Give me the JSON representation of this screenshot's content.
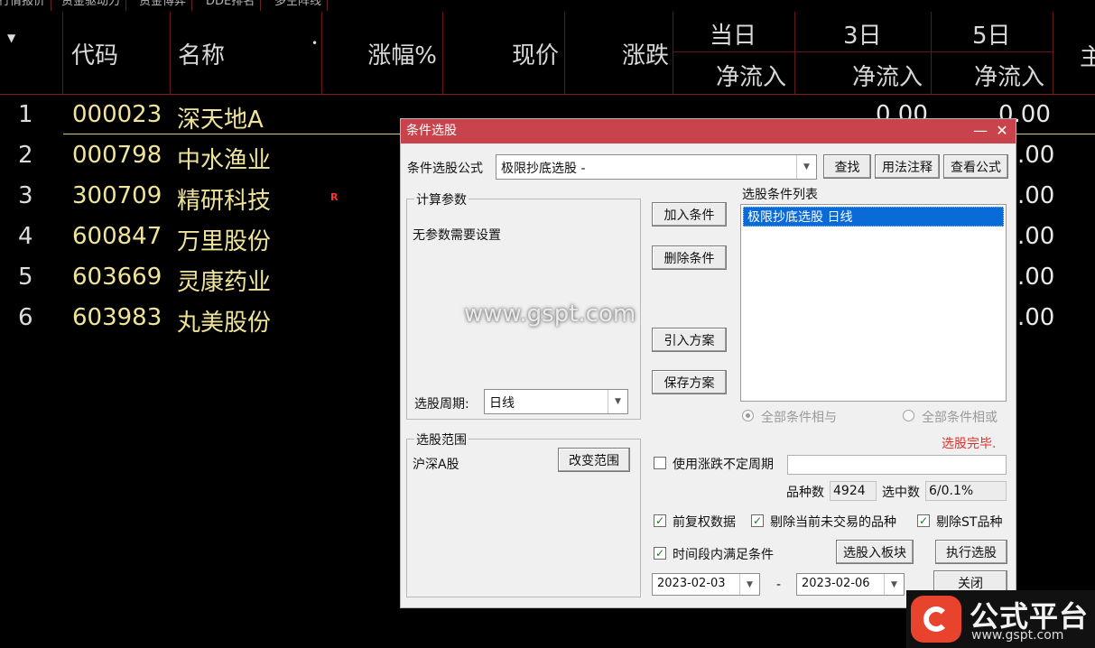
{
  "top_tabs": [
    "行情报价",
    "资金驱动力",
    "资金博弈",
    "DDE排名",
    "多空阵线"
  ],
  "grid": {
    "sort_arrow": "▼",
    "headers": {
      "code": "代码",
      "name": "名称",
      "name_dot": "•",
      "change_pct": "涨幅%",
      "price": "现价",
      "change": "涨跌",
      "day": "当日",
      "d3": "3日",
      "d5": "5日",
      "net_inflow": "净流入",
      "cut_off": "主"
    },
    "rows": [
      {
        "idx": "1",
        "code": "000023",
        "name": "深天地A",
        "mark": "",
        "v1": "0.00",
        "v2": "0.00"
      },
      {
        "idx": "2",
        "code": "000798",
        "name": "中水渔业",
        "mark": "",
        "v1": "",
        "v2": ".00"
      },
      {
        "idx": "3",
        "code": "300709",
        "name": "精研科技",
        "mark": "R",
        "v1": "",
        "v2": ".00"
      },
      {
        "idx": "4",
        "code": "600847",
        "name": "万里股份",
        "mark": "",
        "v1": "",
        "v2": ".00"
      },
      {
        "idx": "5",
        "code": "603669",
        "name": "灵康药业",
        "mark": "",
        "v1": "",
        "v2": ".00"
      },
      {
        "idx": "6",
        "code": "603983",
        "name": "丸美股份",
        "mark": "",
        "v1": "",
        "v2": ".00"
      }
    ]
  },
  "watermark": "www.gspt.com",
  "dialog": {
    "title": "条件选股",
    "minimize": "—",
    "close": "✕",
    "formula_label": "条件选股公式",
    "formula_value": "极限抄底选股 -",
    "find_btn": "查找",
    "usage_btn": "用法注释",
    "view_btn": "查看公式",
    "params_group": "计算参数",
    "params_text": "无参数需要设置",
    "period_label": "选股周期:",
    "period_value": "日线",
    "add_btn": "加入条件",
    "del_btn": "删除条件",
    "import_btn": "引入方案",
    "save_btn": "保存方案",
    "cond_list_label": "选股条件列表",
    "cond_item": "极限抄底选股  日线",
    "radio_and": "全部条件相与",
    "radio_or": "全部条件相或",
    "status": "选股完毕.",
    "range_group": "选股范围",
    "range_value": "沪深A股",
    "change_range_btn": "改变范围",
    "uncertain_period": "使用涨跌不定周期",
    "count_label": "品种数",
    "count_value": "4924",
    "selected_label": "选中数",
    "selected_value": "6/0.1%",
    "opt_forward": "前复权数据",
    "opt_exclude_untraded": "剔除当前未交易的品种",
    "opt_exclude_st": "剔除ST品种",
    "opt_time_range": "时间段内满足条件",
    "to_block_btn": "选股入板块",
    "exec_btn": "执行选股",
    "date_from": "2023-02-03",
    "date_sep": "-",
    "date_to": "2023-02-06",
    "close_btn": "关闭"
  },
  "logo": {
    "title": "公式平台",
    "url": "www.gspt.com"
  },
  "colors": {
    "title_bar": "#c8434b",
    "stock_text": "#f0e49a",
    "status_red": "#e0302a",
    "selection_blue": "#0a6ad8"
  }
}
